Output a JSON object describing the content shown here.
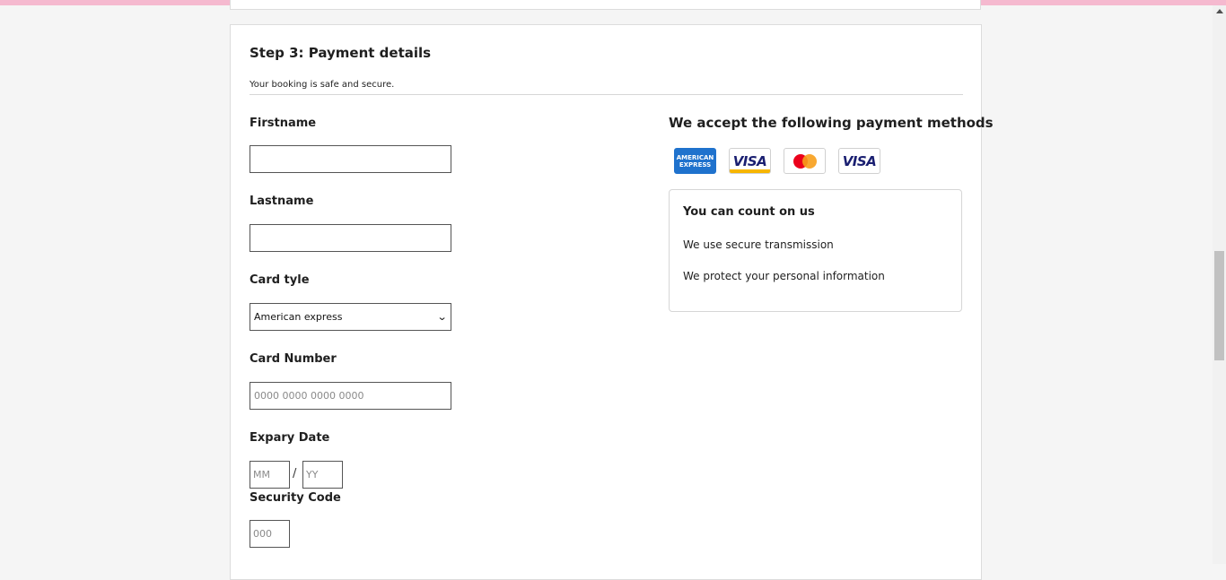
{
  "step": {
    "title": "Step 3: Payment details",
    "subtitle": "Your booking is safe and secure."
  },
  "form": {
    "firstname_label": "Firstname",
    "firstname_value": "",
    "lastname_label": "Lastname",
    "lastname_value": "",
    "card_type_label": "Card tyle",
    "card_type_selected": "American express",
    "card_number_label": "Card Number",
    "card_number_placeholder": "0000 0000 0000 0000",
    "expiry_label": "Expary Date",
    "expiry_month_placeholder": "MM",
    "expiry_separator": "/",
    "expiry_year_placeholder": "YY",
    "security_label": "Security Code",
    "security_placeholder": "000"
  },
  "payment_methods": {
    "title": "We accept the following payment methods",
    "icons": [
      "amex-icon",
      "visa-icon",
      "mastercard-icon",
      "visa-icon"
    ],
    "amex_line1": "AMERICAN",
    "amex_line2": "EXPRESS",
    "visa_text": "VISA"
  },
  "trust": {
    "title": "You can count on us",
    "line1": "We use secure transmission",
    "line2": "We protect your personal information"
  },
  "colors": {
    "top_strip": "#f5b9cf",
    "amex_blue": "#1f72cd",
    "visa_navy": "#1a1f71",
    "mc_red": "#eb001b",
    "mc_orange": "#f79e1b"
  }
}
